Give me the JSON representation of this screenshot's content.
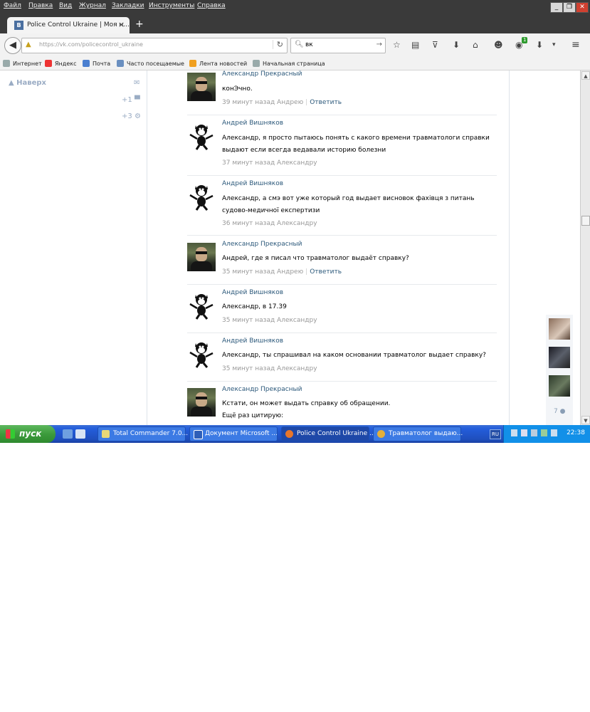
{
  "menu": [
    "Файл",
    "Правка",
    "Вид",
    "Журнал",
    "Закладки",
    "Инструменты",
    "Справка"
  ],
  "tab": {
    "favicon": "В",
    "title": "Police Control Ukraine | Моя н...",
    "close": "×",
    "new": "+"
  },
  "nav": {
    "url": "https://vk.com/policecontrol_ukraine",
    "search_value": "вк",
    "badge": "1"
  },
  "bookmarks": [
    "Интернет",
    "Яндекс",
    "Почта",
    "Часто посещаемые",
    "Лента новостей",
    "Начальная страница"
  ],
  "sidebar": {
    "up": "Наверх",
    "count1": "+1",
    "count3": "+3"
  },
  "comments": [
    {
      "author": "Александр Прекрасный",
      "text": "конЭчно.",
      "time": "39 минут назад Андрею",
      "reply": "Ответить"
    },
    {
      "author": "Андрей Вишняков",
      "text": "Александр, я просто пытаюсь понять с какого времени травматологи справки выдают если всегда ведавали историю болезни",
      "time": "37 минут назад Александру",
      "reply": ""
    },
    {
      "author": "Андрей Вишняков",
      "text": "Александр, а смэ вот уже который год выдает висновок фахівця з питань судово-медичної експертизи",
      "time": "36 минут назад Александру",
      "reply": ""
    },
    {
      "author": "Александр Прекрасный",
      "text": "Андрей, где я писал что травматолог выдаёт справку?",
      "time": "35 минут назад Андрею",
      "reply": "Ответить"
    },
    {
      "author": "Андрей Вишняков",
      "text": "Александр, в 17.39",
      "time": "35 минут назад Александру",
      "reply": ""
    },
    {
      "author": "Андрей Вишняков",
      "text": "Александр, ты спрашивал на каком основании травматолог выдает справку?",
      "time": "35 минут назад Александру",
      "reply": ""
    },
    {
      "author": "Александр Прекрасный",
      "text": "Кстати, он может выдать справку об обращении.\nЕщё раз цитирую:",
      "time": "",
      "reply": ""
    }
  ],
  "friends": {
    "count": "7"
  },
  "taskbar": {
    "start": "пуск",
    "tasks": [
      "Total Commander 7.0...",
      "Документ Microsoft ...",
      "Police Control Ukraine ...",
      "Травматолог выдаю..."
    ],
    "lang": "RU",
    "clock": "22:38"
  },
  "colors": {
    "link": "#2b587a",
    "meta": "#999999",
    "taskbar": "#245edb",
    "start": "#3c9b3c"
  }
}
